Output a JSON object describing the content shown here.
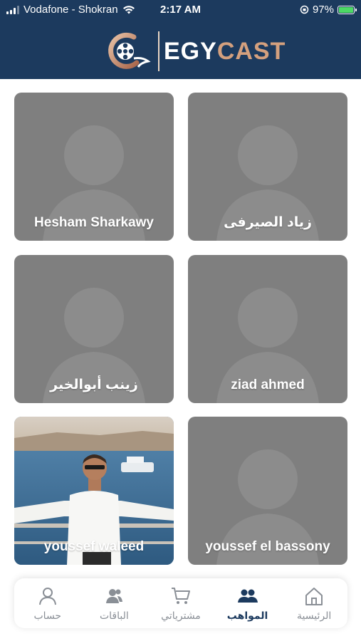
{
  "status_bar": {
    "carrier": "Vodafone - Shokran",
    "time": "2:17 AM",
    "battery": "97%"
  },
  "header": {
    "logo_egy": "EGY",
    "logo_cast": "CAST"
  },
  "talents": [
    {
      "name": "Hesham Sharkawy",
      "has_photo": false
    },
    {
      "name": "زياد الصيرفى",
      "has_photo": false
    },
    {
      "name": "زينب أبوالخير",
      "has_photo": false
    },
    {
      "name": "ziad ahmed",
      "has_photo": false
    },
    {
      "name": "youssef waleed",
      "has_photo": true
    },
    {
      "name": "youssef el bassony",
      "has_photo": false
    }
  ],
  "bottom_nav": {
    "items": [
      {
        "label": "حساب",
        "icon": "person-icon",
        "active": false
      },
      {
        "label": "الباقات",
        "icon": "packages-icon",
        "active": false
      },
      {
        "label": "مشترياتي",
        "icon": "cart-icon",
        "active": false
      },
      {
        "label": "المواهب",
        "icon": "talents-icon",
        "active": true
      },
      {
        "label": "الرئيسية",
        "icon": "home-icon",
        "active": false
      }
    ]
  },
  "colors": {
    "header_bg": "#1c3a5e",
    "accent": "#d4a07e",
    "card_bg": "#7f7f7f",
    "nav_active": "#1c3a5e"
  }
}
